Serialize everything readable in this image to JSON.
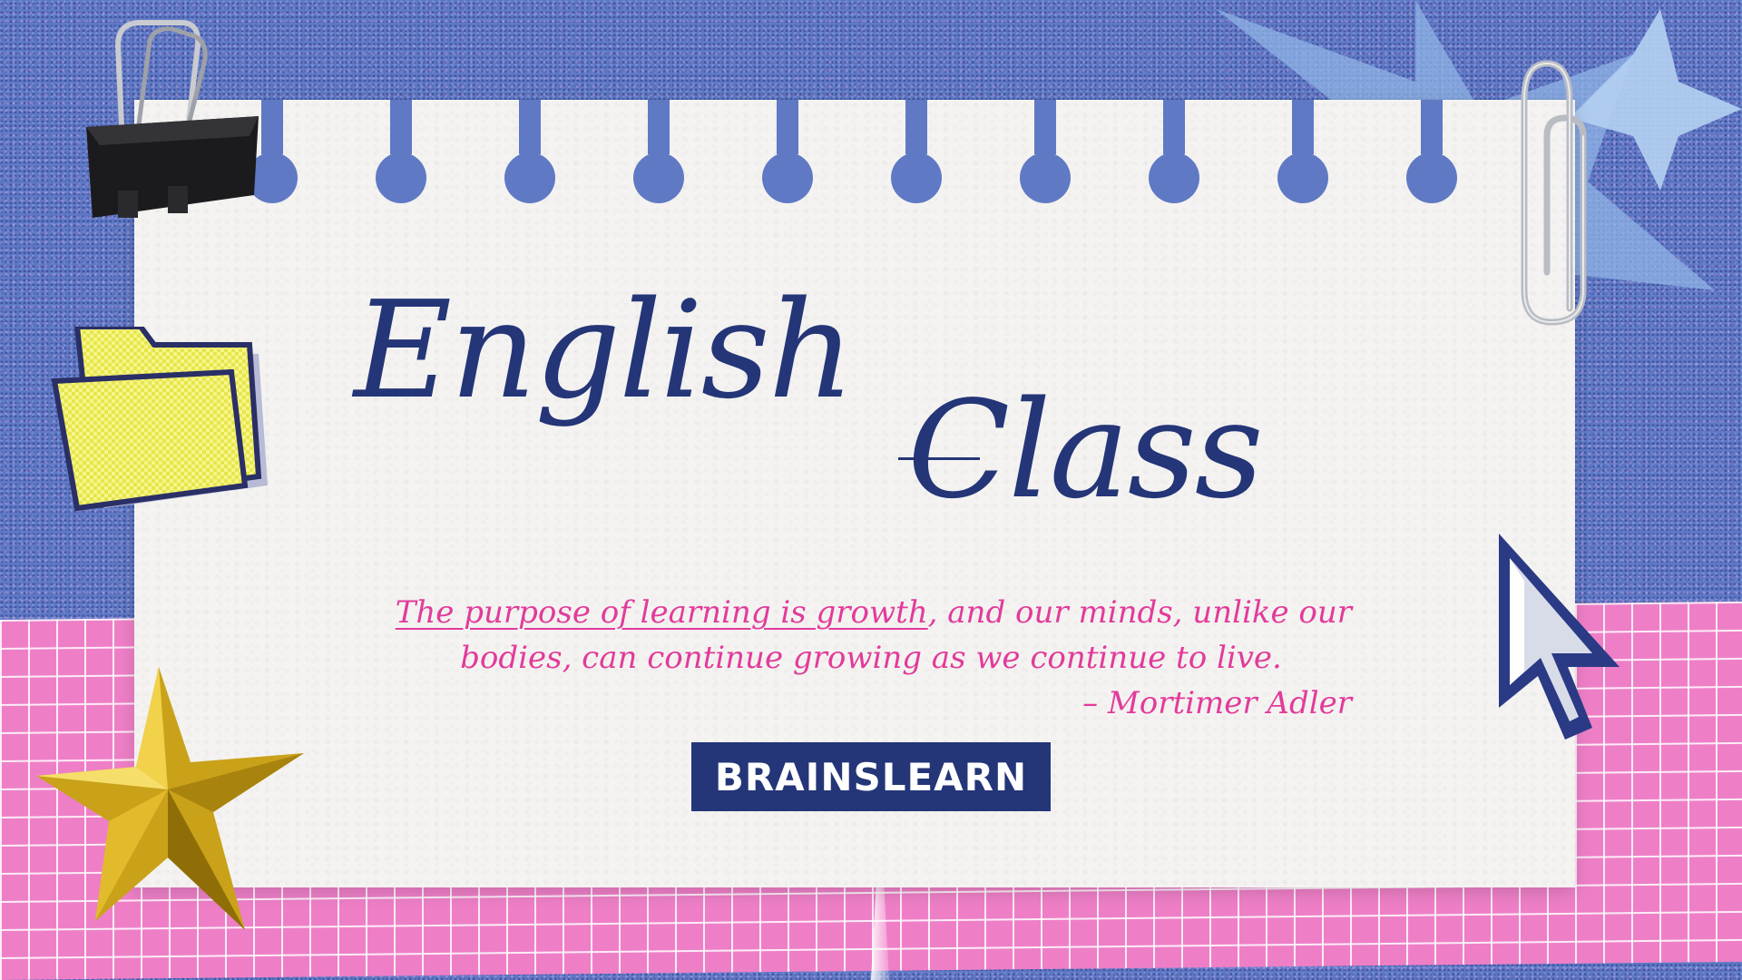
{
  "slide": {
    "title_word1": "English",
    "title_word2": "Class",
    "quote": {
      "underlined_part": "The purpose of learning is growth",
      "rest_line1": ", and our minds, unlike our",
      "line2": "bodies, can continue growing as we continue to live.",
      "author": "– Mortimer Adler"
    },
    "brand": "BRAINSLEARN"
  },
  "colors": {
    "background_blue": "#5f79c4",
    "pink_grid": "#ee7fc7",
    "paper": "#f4f3f1",
    "title_navy": "#243578",
    "quote_pink": "#e23b9b"
  },
  "icons": [
    "binder-clip-icon",
    "paper-clip-icon",
    "folder-icon",
    "gold-star-icon",
    "mouse-cursor-icon",
    "blue-star-icon"
  ]
}
